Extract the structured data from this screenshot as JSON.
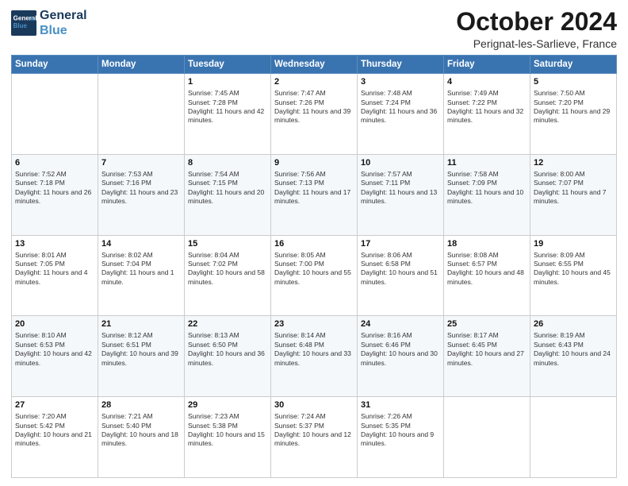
{
  "header": {
    "logo_line1": "General",
    "logo_line2": "Blue",
    "month": "October 2024",
    "location": "Perignat-les-Sarlieve, France"
  },
  "weekdays": [
    "Sunday",
    "Monday",
    "Tuesday",
    "Wednesday",
    "Thursday",
    "Friday",
    "Saturday"
  ],
  "weeks": [
    [
      {
        "day": "",
        "info": ""
      },
      {
        "day": "",
        "info": ""
      },
      {
        "day": "1",
        "info": "Sunrise: 7:45 AM\nSunset: 7:28 PM\nDaylight: 11 hours and 42 minutes."
      },
      {
        "day": "2",
        "info": "Sunrise: 7:47 AM\nSunset: 7:26 PM\nDaylight: 11 hours and 39 minutes."
      },
      {
        "day": "3",
        "info": "Sunrise: 7:48 AM\nSunset: 7:24 PM\nDaylight: 11 hours and 36 minutes."
      },
      {
        "day": "4",
        "info": "Sunrise: 7:49 AM\nSunset: 7:22 PM\nDaylight: 11 hours and 32 minutes."
      },
      {
        "day": "5",
        "info": "Sunrise: 7:50 AM\nSunset: 7:20 PM\nDaylight: 11 hours and 29 minutes."
      }
    ],
    [
      {
        "day": "6",
        "info": "Sunrise: 7:52 AM\nSunset: 7:18 PM\nDaylight: 11 hours and 26 minutes."
      },
      {
        "day": "7",
        "info": "Sunrise: 7:53 AM\nSunset: 7:16 PM\nDaylight: 11 hours and 23 minutes."
      },
      {
        "day": "8",
        "info": "Sunrise: 7:54 AM\nSunset: 7:15 PM\nDaylight: 11 hours and 20 minutes."
      },
      {
        "day": "9",
        "info": "Sunrise: 7:56 AM\nSunset: 7:13 PM\nDaylight: 11 hours and 17 minutes."
      },
      {
        "day": "10",
        "info": "Sunrise: 7:57 AM\nSunset: 7:11 PM\nDaylight: 11 hours and 13 minutes."
      },
      {
        "day": "11",
        "info": "Sunrise: 7:58 AM\nSunset: 7:09 PM\nDaylight: 11 hours and 10 minutes."
      },
      {
        "day": "12",
        "info": "Sunrise: 8:00 AM\nSunset: 7:07 PM\nDaylight: 11 hours and 7 minutes."
      }
    ],
    [
      {
        "day": "13",
        "info": "Sunrise: 8:01 AM\nSunset: 7:05 PM\nDaylight: 11 hours and 4 minutes."
      },
      {
        "day": "14",
        "info": "Sunrise: 8:02 AM\nSunset: 7:04 PM\nDaylight: 11 hours and 1 minute."
      },
      {
        "day": "15",
        "info": "Sunrise: 8:04 AM\nSunset: 7:02 PM\nDaylight: 10 hours and 58 minutes."
      },
      {
        "day": "16",
        "info": "Sunrise: 8:05 AM\nSunset: 7:00 PM\nDaylight: 10 hours and 55 minutes."
      },
      {
        "day": "17",
        "info": "Sunrise: 8:06 AM\nSunset: 6:58 PM\nDaylight: 10 hours and 51 minutes."
      },
      {
        "day": "18",
        "info": "Sunrise: 8:08 AM\nSunset: 6:57 PM\nDaylight: 10 hours and 48 minutes."
      },
      {
        "day": "19",
        "info": "Sunrise: 8:09 AM\nSunset: 6:55 PM\nDaylight: 10 hours and 45 minutes."
      }
    ],
    [
      {
        "day": "20",
        "info": "Sunrise: 8:10 AM\nSunset: 6:53 PM\nDaylight: 10 hours and 42 minutes."
      },
      {
        "day": "21",
        "info": "Sunrise: 8:12 AM\nSunset: 6:51 PM\nDaylight: 10 hours and 39 minutes."
      },
      {
        "day": "22",
        "info": "Sunrise: 8:13 AM\nSunset: 6:50 PM\nDaylight: 10 hours and 36 minutes."
      },
      {
        "day": "23",
        "info": "Sunrise: 8:14 AM\nSunset: 6:48 PM\nDaylight: 10 hours and 33 minutes."
      },
      {
        "day": "24",
        "info": "Sunrise: 8:16 AM\nSunset: 6:46 PM\nDaylight: 10 hours and 30 minutes."
      },
      {
        "day": "25",
        "info": "Sunrise: 8:17 AM\nSunset: 6:45 PM\nDaylight: 10 hours and 27 minutes."
      },
      {
        "day": "26",
        "info": "Sunrise: 8:19 AM\nSunset: 6:43 PM\nDaylight: 10 hours and 24 minutes."
      }
    ],
    [
      {
        "day": "27",
        "info": "Sunrise: 7:20 AM\nSunset: 5:42 PM\nDaylight: 10 hours and 21 minutes."
      },
      {
        "day": "28",
        "info": "Sunrise: 7:21 AM\nSunset: 5:40 PM\nDaylight: 10 hours and 18 minutes."
      },
      {
        "day": "29",
        "info": "Sunrise: 7:23 AM\nSunset: 5:38 PM\nDaylight: 10 hours and 15 minutes."
      },
      {
        "day": "30",
        "info": "Sunrise: 7:24 AM\nSunset: 5:37 PM\nDaylight: 10 hours and 12 minutes."
      },
      {
        "day": "31",
        "info": "Sunrise: 7:26 AM\nSunset: 5:35 PM\nDaylight: 10 hours and 9 minutes."
      },
      {
        "day": "",
        "info": ""
      },
      {
        "day": "",
        "info": ""
      }
    ]
  ]
}
